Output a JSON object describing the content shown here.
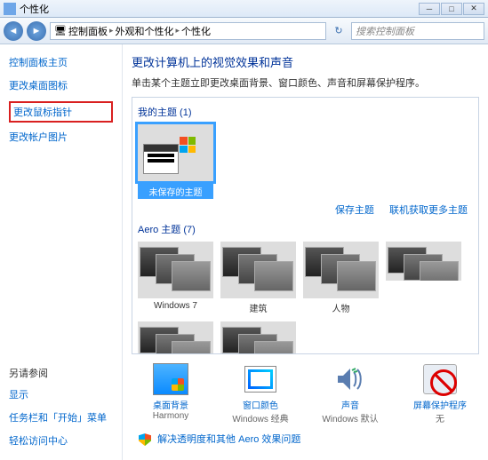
{
  "window": {
    "title": "个性化"
  },
  "breadcrumb": {
    "a": "控制面板",
    "b": "外观和个性化",
    "c": "个性化"
  },
  "search": {
    "placeholder": "搜索控制面板"
  },
  "sidebar": {
    "home": "控制面板主页",
    "links": [
      "更改桌面图标",
      "更改鼠标指针",
      "更改帐户图片"
    ],
    "also_label": "另请参阅",
    "also": [
      "显示",
      "任务栏和「开始」菜单",
      "轻松访问中心"
    ]
  },
  "main": {
    "heading": "更改计算机上的视觉效果和声音",
    "sub": "单击某个主题立即更改桌面背景、窗口颜色、声音和屏幕保护程序。"
  },
  "themes": {
    "my_label": "我的主题 (1)",
    "unsaved": "未保存的主题",
    "save_link": "保存主题",
    "online_link": "联机获取更多主题",
    "aero_label": "Aero 主题 (7)",
    "aero": [
      "Windows 7",
      "建筑",
      "人物"
    ]
  },
  "bottom": {
    "bg": {
      "label": "桌面背景",
      "value": "Harmony"
    },
    "color": {
      "label": "窗口颜色",
      "value": "Windows 经典"
    },
    "sound": {
      "label": "声音",
      "value": "Windows 默认"
    },
    "saver": {
      "label": "屏幕保护程序",
      "value": "无"
    }
  },
  "trouble": {
    "link": "解决透明度和其他 Aero 效果问题"
  }
}
